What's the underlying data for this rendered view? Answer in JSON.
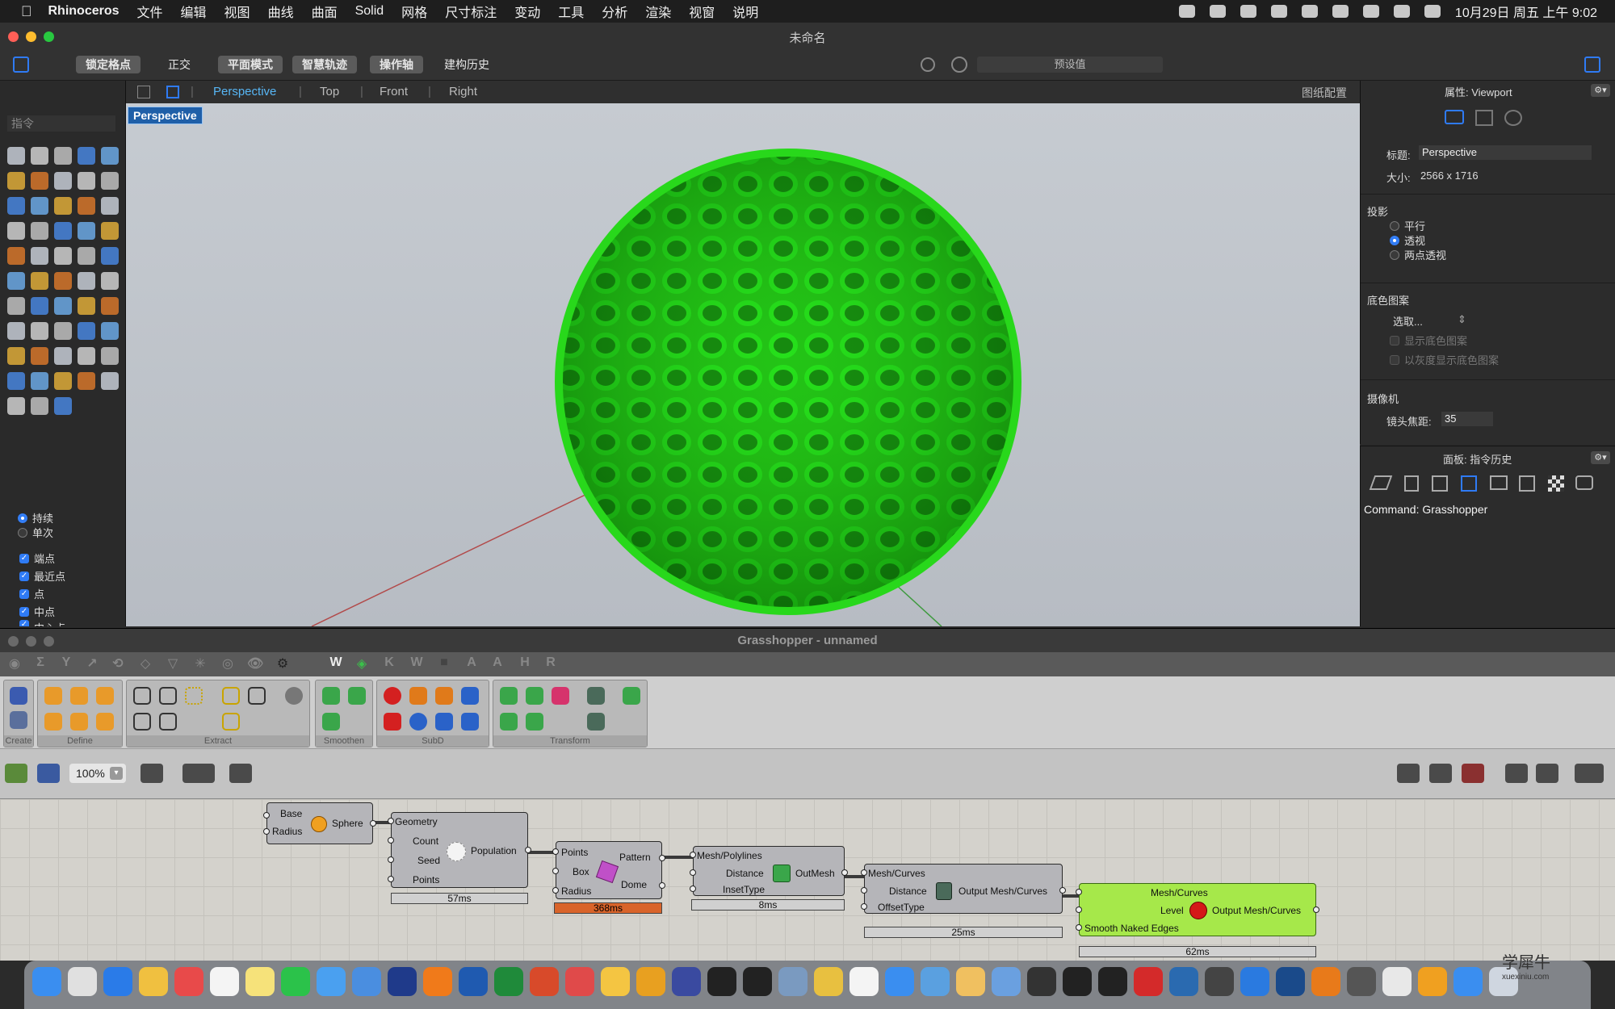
{
  "menubar": {
    "app_name": "Rhinoceros",
    "items": [
      "文件",
      "编辑",
      "视图",
      "曲线",
      "曲面",
      "Solid",
      "网格",
      "尺寸标注",
      "变动",
      "工具",
      "分析",
      "渲染",
      "视窗",
      "说明"
    ],
    "clock": "10月29日 周五 上午 9:02"
  },
  "rhino": {
    "window_title": "未命名",
    "toolbar": {
      "grid_snap": "锁定格点",
      "ortho": "正交",
      "planar": "平面模式",
      "smart_track": "智慧轨迹",
      "gumball": "操作轴",
      "history": "建构历史",
      "preset": "预设值"
    },
    "command_placeholder": "指令",
    "osnap_mode": {
      "persistent": "持续",
      "once": "单次"
    },
    "osnaps": [
      {
        "label": "端点",
        "checked": true
      },
      {
        "label": "最近点",
        "checked": true
      },
      {
        "label": "点",
        "checked": true
      },
      {
        "label": "中点",
        "checked": true
      },
      {
        "label": "中心点",
        "checked": true
      }
    ],
    "viewport_tabs": [
      "Perspective",
      "Top",
      "Front",
      "Right"
    ],
    "active_viewport": "Perspective",
    "layout_label": "图纸配置",
    "viewport_label": "Perspective"
  },
  "properties": {
    "header": "属性: Viewport",
    "title_label": "标题:",
    "title_value": "Perspective",
    "size_label": "大小:",
    "size_value": "2566 x 1716",
    "projection_header": "投影",
    "projection_options": [
      {
        "label": "平行",
        "selected": false
      },
      {
        "label": "透视",
        "selected": true
      },
      {
        "label": "两点透视",
        "selected": false
      }
    ],
    "wallpaper_header": "底色图案",
    "wallpaper_select": "选取...",
    "show_wallpaper": "显示底色图案",
    "gray_wallpaper": "以灰度显示底色图案",
    "camera_header": "摄像机",
    "focal_label": "镜头焦距:",
    "focal_value": "35"
  },
  "panel2": {
    "header": "面板: 指令历史",
    "history_line": "Command: Grasshopper"
  },
  "grasshopper": {
    "window_title": "Grasshopper - unnamed",
    "category_tabs": [
      "W",
      "K",
      "W",
      "A",
      "A",
      "H",
      "R"
    ],
    "ribbon_groups": [
      "Create",
      "Define",
      "Extract",
      "Smoothen",
      "SubD",
      "Transform"
    ],
    "zoom": "100%",
    "nodes": {
      "sphere": {
        "inputs": [
          "Base",
          "Radius"
        ],
        "name": "Sphere"
      },
      "population": {
        "inputs": [
          "Geometry",
          "Count",
          "Seed",
          "Points"
        ],
        "output": "Population",
        "time": "57ms"
      },
      "voronoi": {
        "inputs": [
          "Points",
          "Box",
          "Radius"
        ],
        "outputs": [
          "Pattern",
          "Dome"
        ],
        "time": "368ms"
      },
      "mesh1": {
        "inputs": [
          "Mesh/Polylines",
          "Distance",
          "InsetType"
        ],
        "output": "OutMesh",
        "time": "8ms"
      },
      "mesh2": {
        "inputs": [
          "Mesh/Curves",
          "Distance",
          "OffsetType"
        ],
        "output": "Output Mesh/Curves",
        "time": "25ms"
      },
      "mesh3": {
        "inputs": [
          "Mesh/Curves",
          "Level",
          "Smooth Naked Edges"
        ],
        "output": "Output Mesh/Curves",
        "time": "62ms"
      }
    }
  },
  "watermark": {
    "text": "学犀牛",
    "url": "xuexiniu.com"
  },
  "colors": {
    "accent": "#2f7bf5",
    "mesh_green": "#1fbf12",
    "node_green": "#a6e84a",
    "timer_hot": "#d9642a"
  }
}
